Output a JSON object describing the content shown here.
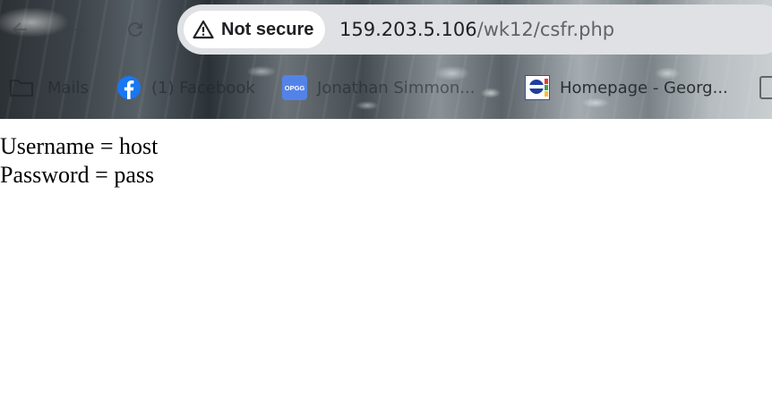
{
  "browser": {
    "security_label": "Not secure",
    "url_host": "159.203.5.106",
    "url_path": "/wk12/csfr.php",
    "bookmarks": [
      {
        "label": "Mails",
        "icon": "folder-icon"
      },
      {
        "label": "(1) Facebook",
        "icon": "facebook-icon"
      },
      {
        "label": "Jonathan Simmon...",
        "icon": "opgg-icon",
        "icon_text": "OPGG"
      },
      {
        "label": "Homepage - Georg...",
        "icon": "georgetown-icon"
      }
    ],
    "colors": {
      "facebook": "#1877f2",
      "opgg": "#5383e8",
      "omnibox": "#dfe1e4"
    }
  },
  "page": {
    "lines": [
      "Username = host",
      "Password = pass"
    ]
  }
}
